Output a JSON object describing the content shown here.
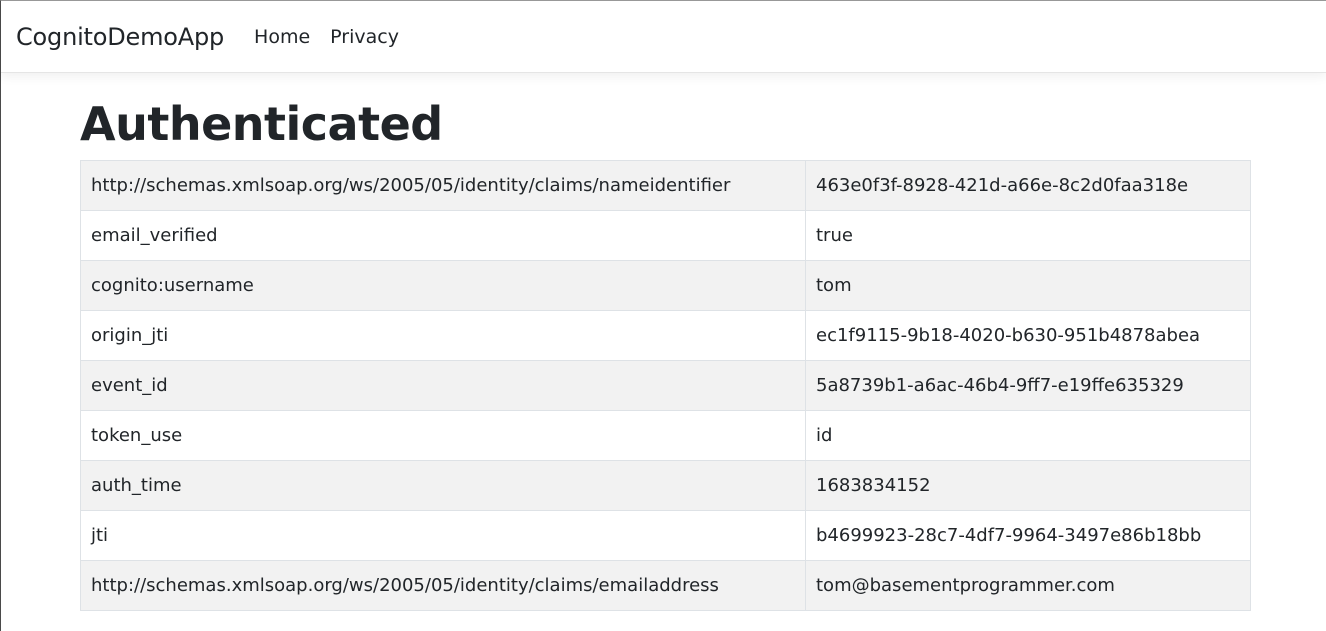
{
  "navbar": {
    "brand": "CognitoDemoApp",
    "links": [
      {
        "label": "Home"
      },
      {
        "label": "Privacy"
      }
    ]
  },
  "main": {
    "title": "Authenticated",
    "claims": [
      {
        "type": "http://schemas.xmlsoap.org/ws/2005/05/identity/claims/nameidentifier",
        "value": "463e0f3f-8928-421d-a66e-8c2d0faa318e"
      },
      {
        "type": "email_verified",
        "value": "true"
      },
      {
        "type": "cognito:username",
        "value": "tom"
      },
      {
        "type": "origin_jti",
        "value": "ec1f9115-9b18-4020-b630-951b4878abea"
      },
      {
        "type": "event_id",
        "value": "5a8739b1-a6ac-46b4-9ff7-e19ffe635329"
      },
      {
        "type": "token_use",
        "value": "id"
      },
      {
        "type": "auth_time",
        "value": "1683834152"
      },
      {
        "type": "jti",
        "value": "b4699923-28c7-4df7-9964-3497e86b18bb"
      },
      {
        "type": "http://schemas.xmlsoap.org/ws/2005/05/identity/claims/emailaddress",
        "value": "tom@basementprogrammer.com"
      }
    ]
  },
  "colors": {
    "striped_row": "#f2f2f2",
    "border": "#dee2e6",
    "text": "#212529"
  }
}
